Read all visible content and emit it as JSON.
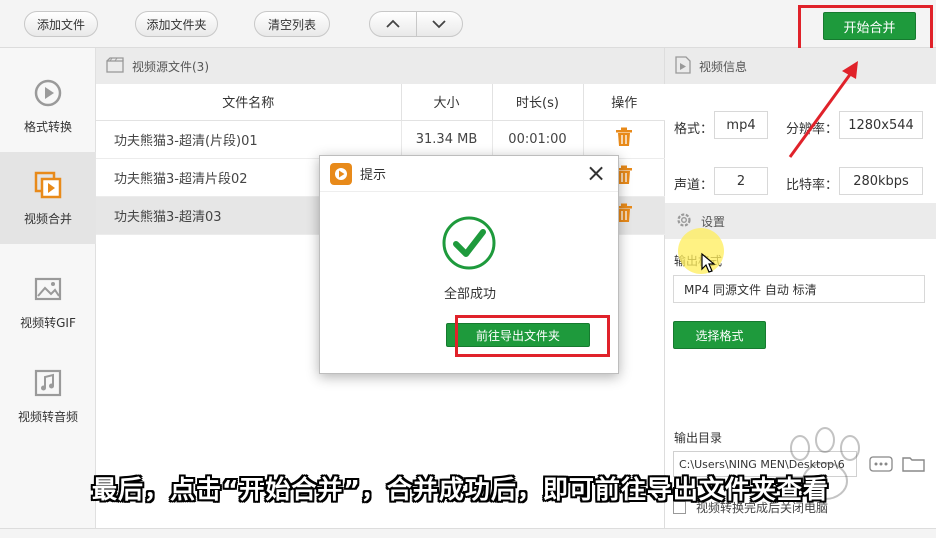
{
  "toolbar": {
    "add_file": "添加文件",
    "add_folder": "添加文件夹",
    "clear_list": "清空列表",
    "start_merge": "开始合并"
  },
  "sidebar": {
    "items": [
      {
        "label": "格式转换",
        "icon": "play-circle-icon"
      },
      {
        "label": "视频合并",
        "icon": "merge-icon"
      },
      {
        "label": "视频转GIF",
        "icon": "image-icon"
      },
      {
        "label": "视频转音频",
        "icon": "music-icon"
      }
    ],
    "active_index": 1
  },
  "file_panel": {
    "title": "视频源文件(3)",
    "columns": [
      "文件名称",
      "大小",
      "时长(s)",
      "操作"
    ],
    "rows": [
      {
        "name": "功夫熊猫3-超清(片段)01",
        "size": "31.34 MB",
        "duration": "00:01:00"
      },
      {
        "name": "功夫熊猫3-超清片段02",
        "size": "",
        "duration": ""
      },
      {
        "name": "功夫熊猫3-超清03",
        "size": "",
        "duration": ""
      }
    ]
  },
  "video_info": {
    "title": "视频信息",
    "format_label": "格式：",
    "format_value": "mp4",
    "resolution_label": "分辨率：",
    "resolution_value": "1280x544",
    "channel_label": "声道：",
    "channel_value": "2",
    "bitrate_label": "比特率：",
    "bitrate_value": "280kbps"
  },
  "settings": {
    "title": "设置",
    "output_format_label": "输出格式",
    "output_format_value": "MP4 同源文件 自动 标清",
    "choose_format": "选择格式",
    "output_dir_label": "输出目录",
    "output_dir_value": "C:\\Users\\NING MEN\\Desktop\\6",
    "close_after_label": "视频转换完成后关闭电脑"
  },
  "dialog": {
    "title": "提示",
    "message": "全部成功",
    "go_folder": "前往导出文件夹"
  },
  "subtitle": "最后，点击“开始合并”，合并成功后，即可前往导出文件夹查看",
  "colors": {
    "accent_green": "#1e9a3c",
    "highlight_red": "#e0222a",
    "icon_orange": "#e88a1a"
  }
}
